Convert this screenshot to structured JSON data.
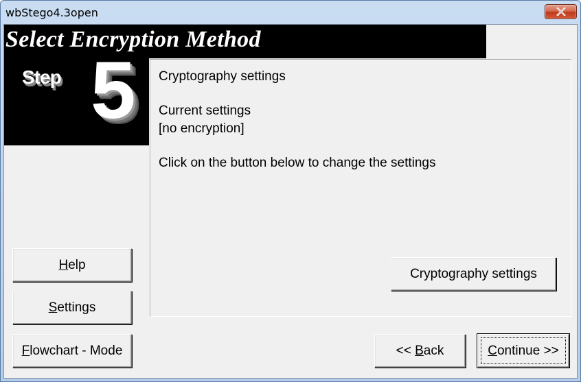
{
  "window": {
    "title": "wbStego4.3open"
  },
  "banner": {
    "title": "Select Encryption Method"
  },
  "step": {
    "word": "Step",
    "number": "5"
  },
  "content": {
    "heading": "Cryptography settings",
    "current_label": "Current settings",
    "current_value": "[no encryption]",
    "instruction": "Click on the button below to change the settings"
  },
  "buttons": {
    "help": {
      "mnemonic": "H",
      "rest": "elp"
    },
    "settings": {
      "mnemonic": "S",
      "rest": "ettings"
    },
    "flowchart": {
      "mnemonic": "F",
      "rest": "lowchart - Mode"
    },
    "crypto": "Cryptography settings",
    "back": {
      "prefix": "<< ",
      "mnemonic": "B",
      "rest": "ack"
    },
    "continue": {
      "mnemonic": "C",
      "rest": "ontinue >>"
    }
  },
  "icons": {
    "close": "close-icon"
  },
  "colors": {
    "banner_bg": "#000000",
    "panel_bg": "#f0f0f0",
    "close_button": "#c0391b"
  }
}
